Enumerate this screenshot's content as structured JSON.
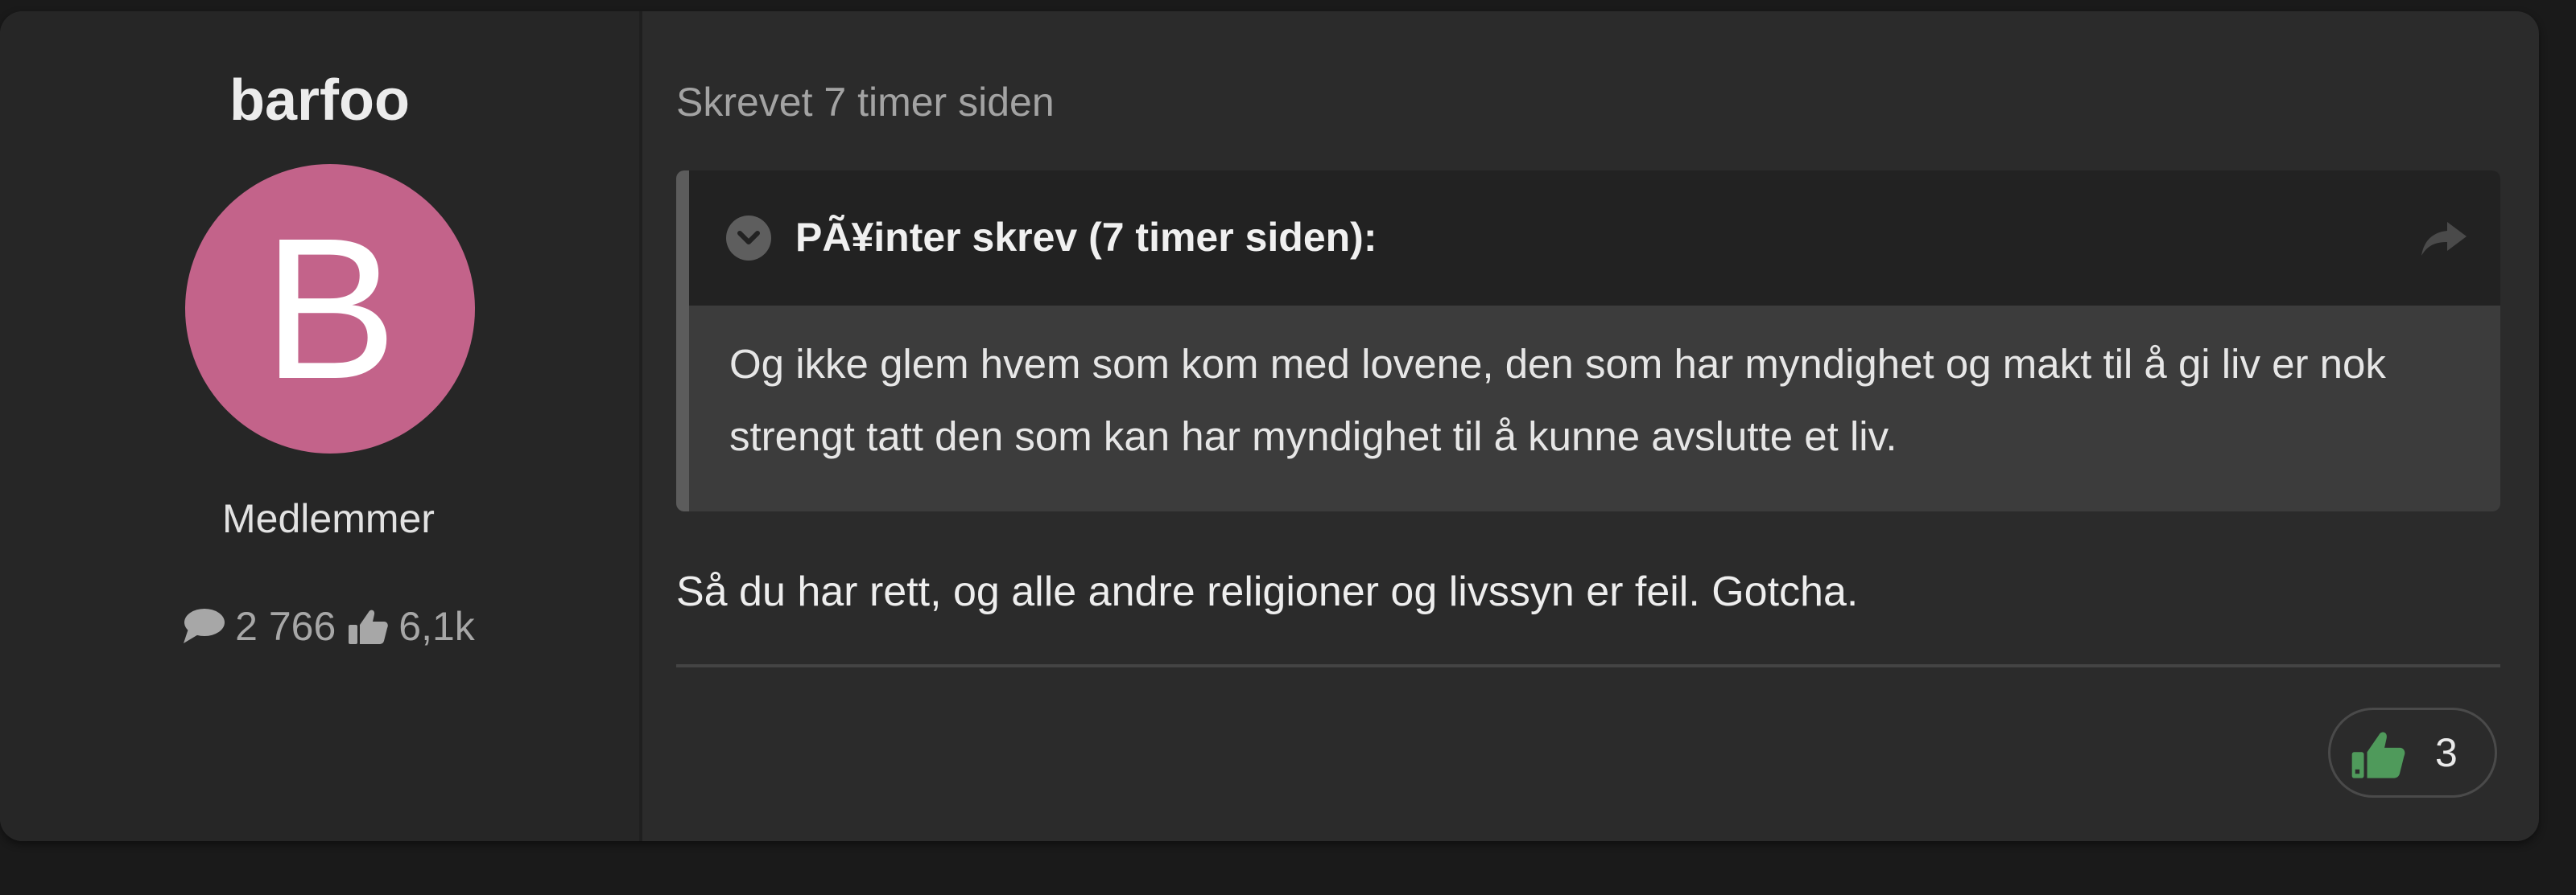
{
  "author": {
    "name": "barfoo",
    "avatar_letter": "B",
    "avatar_color": "#c3638a",
    "role": "Medlemmer",
    "stats": {
      "posts_icon": "speech-bubble-icon",
      "posts": "2 766",
      "reputation_icon": "thumbs-up-icon",
      "reputation": "6,1k"
    }
  },
  "post": {
    "meta": "Skrevet 7 timer siden",
    "quote": {
      "toggle_icon": "chevron-down-circle-icon",
      "header": "PÃ¥inter skrev (7 timer siden):",
      "share_icon": "share-icon",
      "text": "Og ikke glem hvem som kom med lovene, den som har myndighet og makt til å gi liv er nok strengt tatt den som kan har myndighet til å kunne avslutte et liv."
    },
    "body": "Så du har rett, og alle andre religioner og livssyn er feil. Gotcha.",
    "reaction": {
      "icon": "thumbs-up-icon",
      "icon_color": "#4f9a5b",
      "count": "3"
    }
  }
}
